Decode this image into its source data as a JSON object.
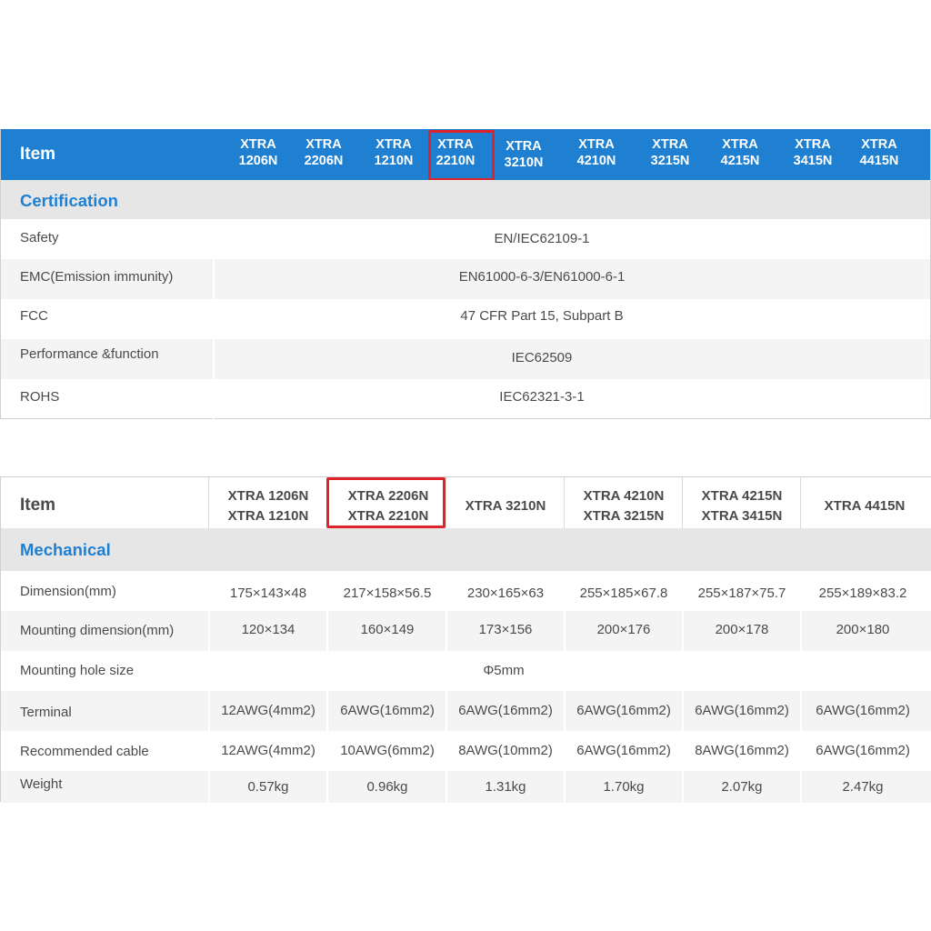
{
  "certification_table": {
    "item_label": "Item",
    "models": [
      [
        "XTRA",
        "1206N"
      ],
      [
        "XTRA",
        "2206N"
      ],
      [
        "XTRA",
        "1210N"
      ],
      [
        "XTRA",
        "2210N"
      ],
      [
        "XTRA",
        "3210N"
      ],
      [
        "XTRA",
        "4210N"
      ],
      [
        "XTRA",
        "3215N"
      ],
      [
        "XTRA",
        "4215N"
      ],
      [
        "XTRA",
        "3415N"
      ],
      [
        "XTRA",
        "4415N"
      ]
    ],
    "section_title": "Certification",
    "rows": [
      {
        "label": "Safety",
        "value": "EN/IEC62109-1"
      },
      {
        "label": "EMC(Emission immunity)",
        "value": "EN61000-6-3/EN61000-6-1"
      },
      {
        "label": "FCC",
        "value": "47 CFR Part 15, Subpart B"
      },
      {
        "label": "Performance &function",
        "value": "IEC62509"
      },
      {
        "label": "ROHS",
        "value": "IEC62321-3-1"
      }
    ],
    "colors": {
      "header_bg": "#1f80d1",
      "highlight": "#e0232a"
    }
  },
  "mechanical_table": {
    "item_label": "Item",
    "models": [
      [
        "XTRA 1206N",
        "XTRA 1210N"
      ],
      [
        "XTRA 2206N",
        "XTRA 2210N"
      ],
      [
        "XTRA 3210N"
      ],
      [
        "XTRA 4210N",
        "XTRA 3215N"
      ],
      [
        "XTRA 4215N",
        "XTRA 3415N"
      ],
      [
        "XTRA 4415N"
      ]
    ],
    "section_title": "Mechanical",
    "rows": [
      {
        "label": "Dimension(mm)",
        "values": [
          "175×143×48",
          "217×158×56.5",
          "230×165×63",
          "255×185×67.8",
          "255×187×75.7",
          "255×189×83.2"
        ]
      },
      {
        "label": "Mounting dimension(mm)",
        "values": [
          "120×134",
          "160×149",
          "173×156",
          "200×176",
          "200×178",
          "200×180"
        ]
      },
      {
        "label": "Mounting hole size",
        "merged_value": "Φ5mm"
      },
      {
        "label": "Terminal",
        "values": [
          "12AWG(4mm2)",
          "6AWG(16mm2)",
          "6AWG(16mm2)",
          "6AWG(16mm2)",
          "6AWG(16mm2)",
          "6AWG(16mm2)"
        ]
      },
      {
        "label": "Recommended cable",
        "values": [
          "12AWG(4mm2)",
          "10AWG(6mm2)",
          "8AWG(10mm2)",
          "6AWG(16mm2)",
          "8AWG(16mm2)",
          "6AWG(16mm2)"
        ]
      },
      {
        "label": "Weight",
        "values": [
          "0.57kg",
          "0.96kg",
          "1.31kg",
          "1.70kg",
          "2.07kg",
          "2.47kg"
        ]
      }
    ],
    "colors": {
      "section_title": "#1f80d1",
      "highlight": "#e0232a"
    }
  }
}
